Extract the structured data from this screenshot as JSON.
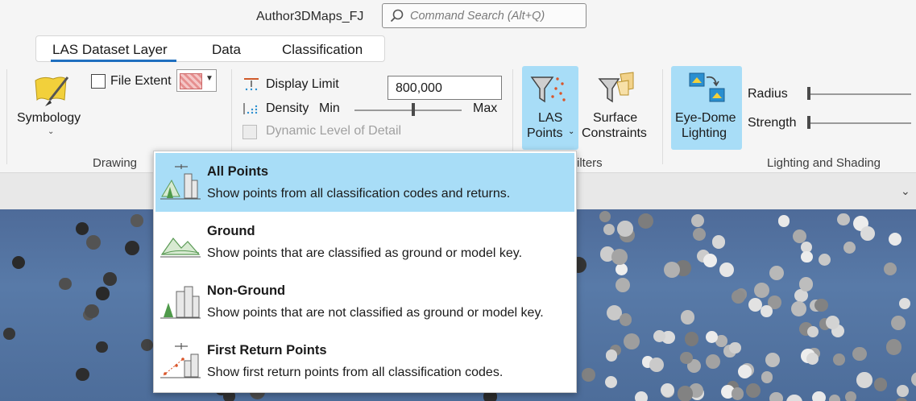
{
  "window": {
    "title": "Author3DMaps_FJ"
  },
  "search": {
    "placeholder": "Command Search (Alt+Q)"
  },
  "tabs": [
    {
      "label": "LAS Dataset Layer",
      "active": true
    },
    {
      "label": "Data"
    },
    {
      "label": "Classification"
    }
  ],
  "drawing": {
    "symbology_label": "Symbology",
    "file_extent_label": "File Extent",
    "group_label": "Drawing"
  },
  "display": {
    "display_limit_label": "Display Limit",
    "display_limit_value": "800,000",
    "density_label": "Density",
    "density_min": "Min",
    "density_max": "Max",
    "density_level": 0.55,
    "dynamic_lod_label": "Dynamic Level of Detail"
  },
  "filters": {
    "las_points_line1": "LAS",
    "las_points_line2": "Points",
    "surface_line1": "Surface",
    "surface_line2": "Constraints",
    "group_label_partial": "ilters"
  },
  "lighting": {
    "edl_line1": "Eye-Dome",
    "edl_line2": "Lighting",
    "radius_label": "Radius",
    "strength_label": "Strength",
    "group_label": "Lighting and Shading"
  },
  "menu": {
    "items": [
      {
        "title": "All Points",
        "desc": "Show points from all classification codes and returns.",
        "selected": true,
        "icon": "all-points-icon"
      },
      {
        "title": "Ground",
        "desc": "Show points that are classified as ground or model key.",
        "icon": "ground-icon"
      },
      {
        "title": "Non-Ground",
        "desc": "Show points that are not classified as ground or model key.",
        "icon": "non-ground-icon"
      },
      {
        "title": "First Return Points",
        "desc": "Show first return points from all classification codes.",
        "icon": "first-return-icon"
      }
    ]
  },
  "colors": {
    "accent": "#1f6fbf",
    "highlight": "#a8ddf7",
    "map_bg": "#587aa8"
  }
}
